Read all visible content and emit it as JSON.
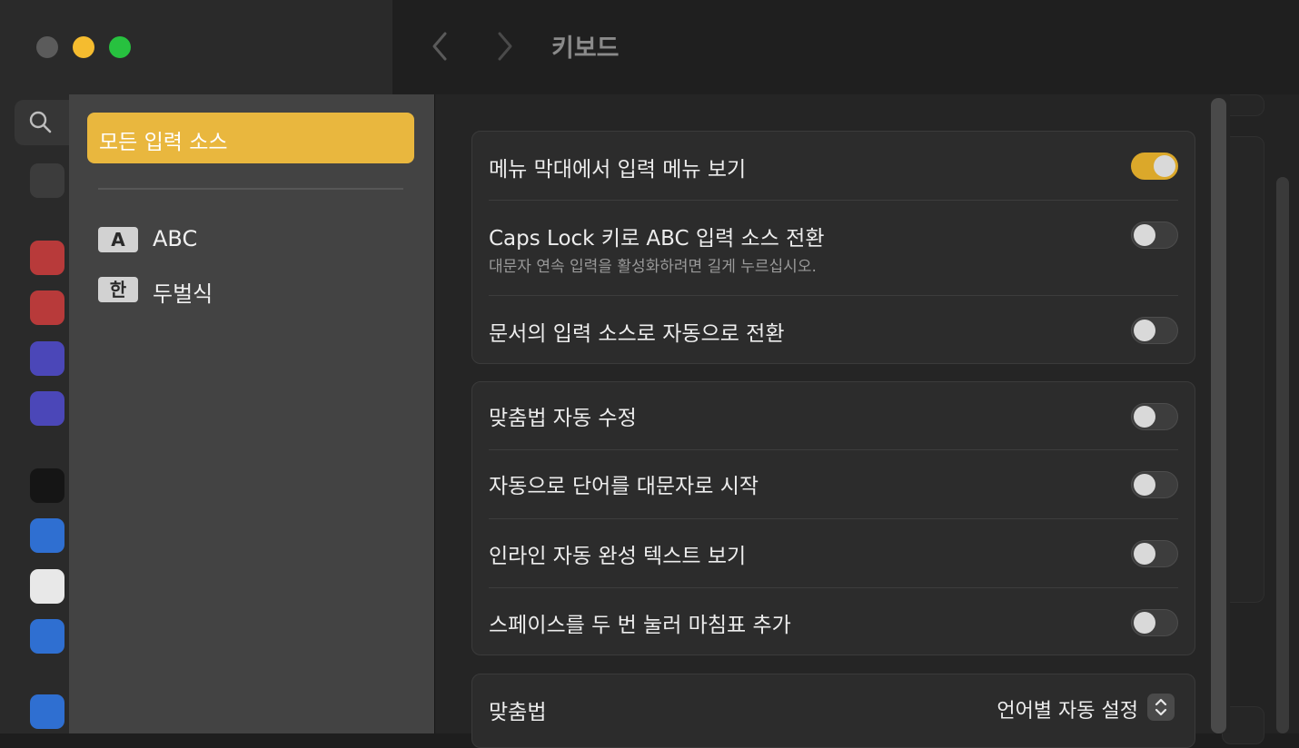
{
  "window": {
    "title": "키보드",
    "colors": {
      "close": "#5b5b5b",
      "minimize": "#f5bc2f",
      "maximize": "#27c13f"
    }
  },
  "sidebar_icons": [
    "search-icon",
    "notifications-icon",
    "sound-icon",
    "focus-moon-icon",
    "screen-time-icon",
    "lock-screen-icon",
    "privacy-hand-icon",
    "touch-id-icon",
    "users-icon",
    "internet-accounts-icon"
  ],
  "input_sources": {
    "selected_label": "모든 입력 소스",
    "items": [
      {
        "badge": "A",
        "label": "ABC"
      },
      {
        "badge": "한",
        "label": "두벌식"
      }
    ]
  },
  "group1": {
    "rows": [
      {
        "label": "메뉴 막대에서 입력 메뉴 보기",
        "on": true
      },
      {
        "label": "Caps Lock 키로 ABC 입력 소스 전환",
        "sub": "대문자 연속 입력을 활성화하려면 길게 누르십시오.",
        "on": false
      },
      {
        "label": "문서의 입력 소스로 자동으로 전환",
        "on": false
      }
    ]
  },
  "group2": {
    "rows": [
      {
        "label": "맞춤법 자동 수정",
        "on": false
      },
      {
        "label": "자동으로 단어를 대문자로 시작",
        "on": false
      },
      {
        "label": "인라인 자동 완성 텍스트 보기",
        "on": false
      },
      {
        "label": "스페이스를 두 번 눌러 마침표 추가",
        "on": false
      }
    ]
  },
  "group3": {
    "label": "맞춤법",
    "value": "언어별 자동 설정"
  },
  "accent": "#e9b73e"
}
